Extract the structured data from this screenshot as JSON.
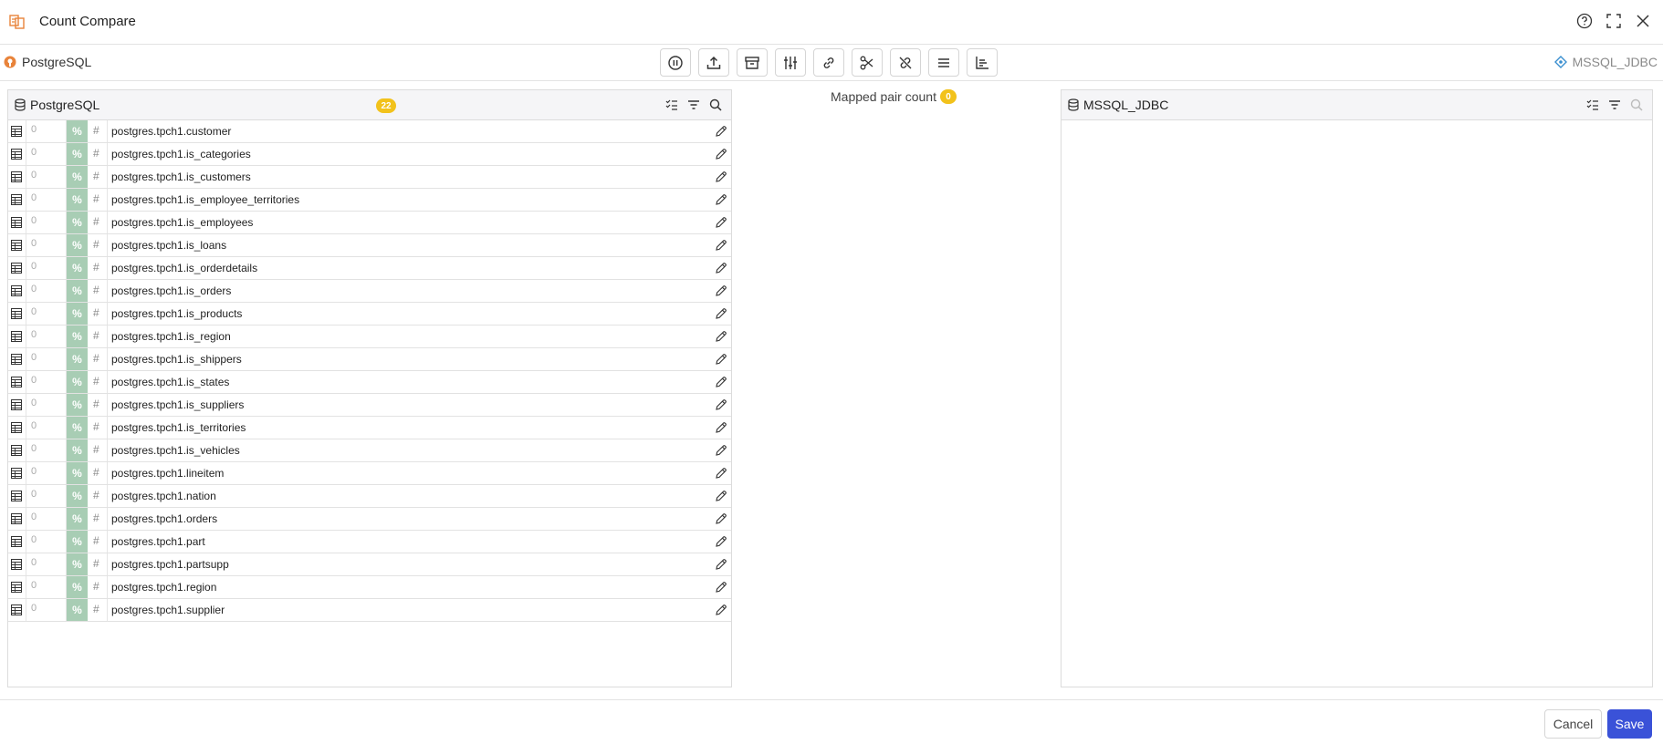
{
  "window": {
    "title": "Count Compare"
  },
  "source": {
    "name": "PostgreSQL"
  },
  "target": {
    "name": "MSSQL_JDBC"
  },
  "toolbar": {
    "tools": [
      "pause-icon",
      "upload-icon",
      "archive-icon",
      "sliders-icon",
      "link-icon",
      "scissors-icon",
      "unlink-icon",
      "list-icon",
      "chart-icon"
    ]
  },
  "left_panel": {
    "title": "PostgreSQL",
    "count": "22",
    "rows": [
      {
        "count": "0",
        "pct": "%",
        "hash": "#",
        "name": "postgres.tpch1.customer"
      },
      {
        "count": "0",
        "pct": "%",
        "hash": "#",
        "name": "postgres.tpch1.is_categories"
      },
      {
        "count": "0",
        "pct": "%",
        "hash": "#",
        "name": "postgres.tpch1.is_customers"
      },
      {
        "count": "0",
        "pct": "%",
        "hash": "#",
        "name": "postgres.tpch1.is_employee_territories"
      },
      {
        "count": "0",
        "pct": "%",
        "hash": "#",
        "name": "postgres.tpch1.is_employees"
      },
      {
        "count": "0",
        "pct": "%",
        "hash": "#",
        "name": "postgres.tpch1.is_loans"
      },
      {
        "count": "0",
        "pct": "%",
        "hash": "#",
        "name": "postgres.tpch1.is_orderdetails"
      },
      {
        "count": "0",
        "pct": "%",
        "hash": "#",
        "name": "postgres.tpch1.is_orders"
      },
      {
        "count": "0",
        "pct": "%",
        "hash": "#",
        "name": "postgres.tpch1.is_products"
      },
      {
        "count": "0",
        "pct": "%",
        "hash": "#",
        "name": "postgres.tpch1.is_region"
      },
      {
        "count": "0",
        "pct": "%",
        "hash": "#",
        "name": "postgres.tpch1.is_shippers"
      },
      {
        "count": "0",
        "pct": "%",
        "hash": "#",
        "name": "postgres.tpch1.is_states"
      },
      {
        "count": "0",
        "pct": "%",
        "hash": "#",
        "name": "postgres.tpch1.is_suppliers"
      },
      {
        "count": "0",
        "pct": "%",
        "hash": "#",
        "name": "postgres.tpch1.is_territories"
      },
      {
        "count": "0",
        "pct": "%",
        "hash": "#",
        "name": "postgres.tpch1.is_vehicles"
      },
      {
        "count": "0",
        "pct": "%",
        "hash": "#",
        "name": "postgres.tpch1.lineitem"
      },
      {
        "count": "0",
        "pct": "%",
        "hash": "#",
        "name": "postgres.tpch1.nation"
      },
      {
        "count": "0",
        "pct": "%",
        "hash": "#",
        "name": "postgres.tpch1.orders"
      },
      {
        "count": "0",
        "pct": "%",
        "hash": "#",
        "name": "postgres.tpch1.part"
      },
      {
        "count": "0",
        "pct": "%",
        "hash": "#",
        "name": "postgres.tpch1.partsupp"
      },
      {
        "count": "0",
        "pct": "%",
        "hash": "#",
        "name": "postgres.tpch1.region"
      },
      {
        "count": "0",
        "pct": "%",
        "hash": "#",
        "name": "postgres.tpch1.supplier"
      }
    ]
  },
  "mapping": {
    "label": "Mapped pair count",
    "count": "0"
  },
  "right_panel": {
    "title": "MSSQL_JDBC"
  },
  "footer": {
    "cancel_label": "Cancel",
    "save_label": "Save"
  },
  "colors": {
    "accent": "#3a52d8",
    "badge": "#f2c21b",
    "pct_cell": "#a8cdb4",
    "source_icon": "#e8833a",
    "target_icon": "#3a8fd0"
  }
}
